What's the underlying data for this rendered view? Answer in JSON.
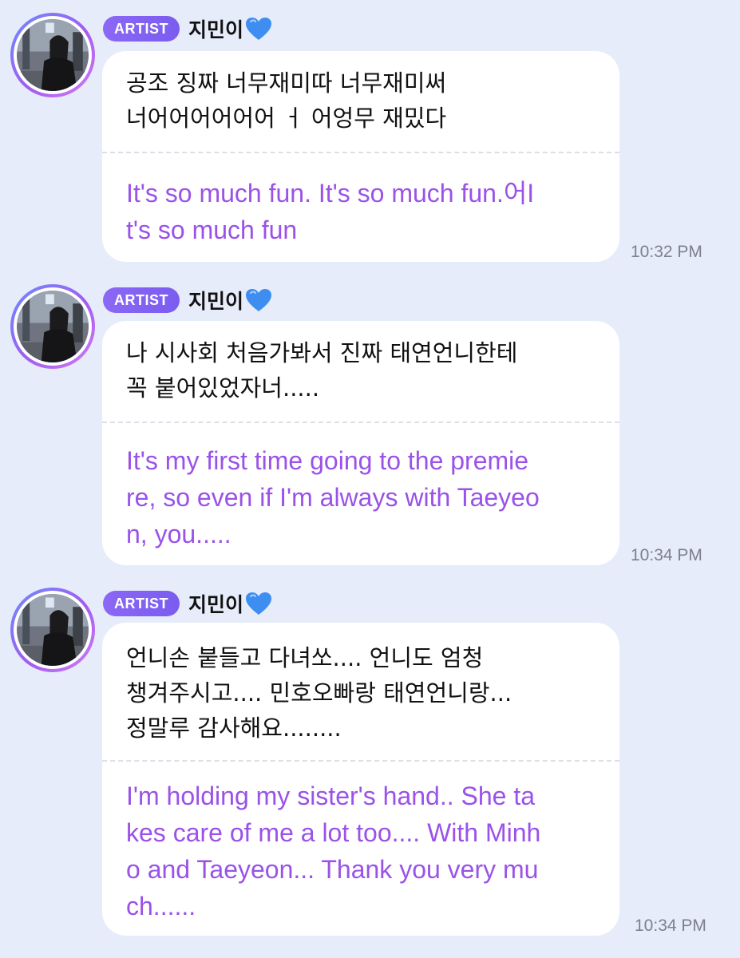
{
  "messages": [
    {
      "badge": "ARTIST",
      "username": "지민이",
      "original": "공조 징짜 너무재미따 너무재미써\n너어어어어어어 ㅓ 어엉무 재밌다",
      "translation": "It's so much fun. It's so much fun.어I\nt's so much fun",
      "time": "10:32 PM"
    },
    {
      "badge": "ARTIST",
      "username": "지민이",
      "original": "나 시사회 처음가봐서 진짜 태연언니한테\n꼭 붙어있었자너.....",
      "translation": "It's my first time going to the premie\nre, so even if I'm always with Taeyeo\nn, you.....",
      "time": "10:34 PM"
    },
    {
      "badge": "ARTIST",
      "username": "지민이",
      "original": "언니손 붙들고 다녀쏘.... 언니도 엄청\n챙겨주시고.... 민호오빠랑 태연언니랑...\n정말루 감사해요........",
      "translation": "I'm holding my sister's hand.. She ta\nkes care of me a lot too.... With Minh\no and Taeyeon... Thank you very mu\nch......",
      "time": "10:34 PM"
    }
  ],
  "icons": {
    "username_suffix": "blue-heart-icon"
  },
  "colors": {
    "background": "#e6ecf9",
    "translation_text": "#9a52e8",
    "badge": "#7a5cf0",
    "heart": "#3d8ef0"
  }
}
